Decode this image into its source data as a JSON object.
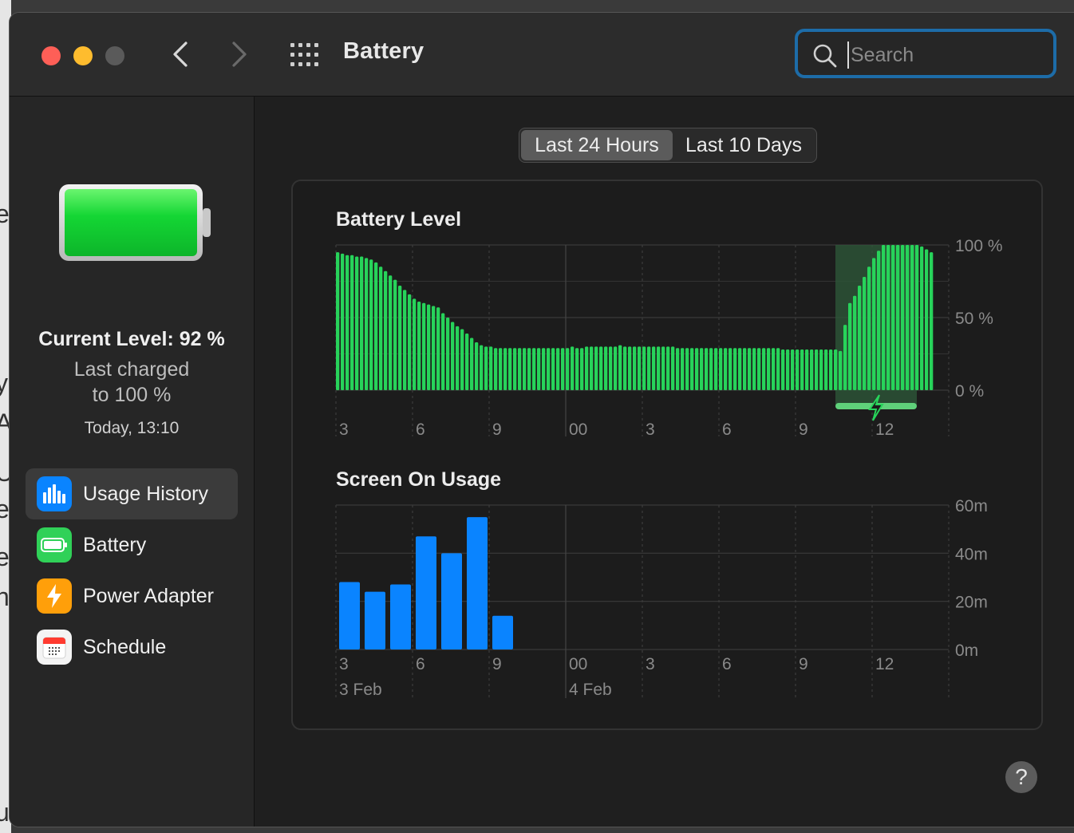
{
  "window": {
    "title": "Battery",
    "search": {
      "placeholder": "Search",
      "value": ""
    }
  },
  "sidebar": {
    "current_level": "Current Level: 92 %",
    "last_charged_line1": "Last charged",
    "last_charged_line2": "to 100 %",
    "last_charged_time": "Today, 13:10",
    "items": [
      {
        "label": "Usage History",
        "icon": "bar-chart-icon",
        "color": "#0a84ff",
        "selected": true
      },
      {
        "label": "Battery",
        "icon": "battery-icon",
        "color": "#30d158",
        "selected": false
      },
      {
        "label": "Power Adapter",
        "icon": "bolt-icon",
        "color": "#ff9f0a",
        "selected": false
      },
      {
        "label": "Schedule",
        "icon": "calendar-icon",
        "color": "#ffffff",
        "selected": false
      }
    ]
  },
  "tabs": [
    {
      "label": "Last 24 Hours",
      "active": true
    },
    {
      "label": "Last 10 Days",
      "active": false
    }
  ],
  "colors": {
    "battery_green": "#27d35a",
    "usage_blue": "#0a84ff",
    "charging_band": "#2e5a39",
    "search_focus": "#1d6ca8"
  },
  "chart_data": [
    {
      "type": "bar",
      "title": "Battery Level",
      "x_tick_labels": [
        "3",
        "6",
        "9",
        "00",
        "3",
        "6",
        "9",
        "12"
      ],
      "y_tick_labels": [
        "100 %",
        "50 %",
        "0 %"
      ],
      "ylim": [
        0,
        100
      ],
      "values": [
        95,
        94,
        93,
        93,
        92,
        92,
        91,
        90,
        88,
        85,
        82,
        79,
        76,
        72,
        69,
        66,
        63,
        61,
        60,
        59,
        58,
        57,
        53,
        50,
        47,
        44,
        42,
        39,
        36,
        33,
        31,
        30,
        30,
        29,
        29,
        29,
        29,
        29,
        29,
        29,
        29,
        29,
        29,
        29,
        29,
        29,
        29,
        29,
        29,
        30,
        29,
        29,
        30,
        30,
        30,
        30,
        30,
        30,
        30,
        31,
        30,
        30,
        30,
        30,
        30,
        30,
        30,
        30,
        30,
        30,
        30,
        29,
        29,
        29,
        29,
        29,
        29,
        29,
        29,
        29,
        29,
        29,
        29,
        29,
        29,
        29,
        29,
        29,
        29,
        29,
        29,
        29,
        29,
        28,
        28,
        28,
        28,
        28,
        28,
        28,
        28,
        28,
        28,
        28,
        28,
        27,
        45,
        60,
        65,
        72,
        78,
        85,
        91,
        96,
        100,
        100,
        100,
        100,
        100,
        100,
        100,
        100,
        99,
        97,
        95
      ],
      "charging_period": {
        "start_index": 105,
        "end_index": 120,
        "icon": "bolt-icon"
      },
      "grid": true
    },
    {
      "type": "bar",
      "title": "Screen On Usage",
      "x_tick_labels": [
        "3",
        "6",
        "9",
        "00",
        "3",
        "6",
        "9",
        "12"
      ],
      "date_labels": [
        "3 Feb",
        "4 Feb"
      ],
      "y_tick_labels": [
        "60m",
        "40m",
        "20m",
        "0m"
      ],
      "ylim": [
        0,
        60
      ],
      "values_minutes": [
        28,
        24,
        27,
        47,
        40,
        55,
        14
      ],
      "grid": true
    }
  ]
}
